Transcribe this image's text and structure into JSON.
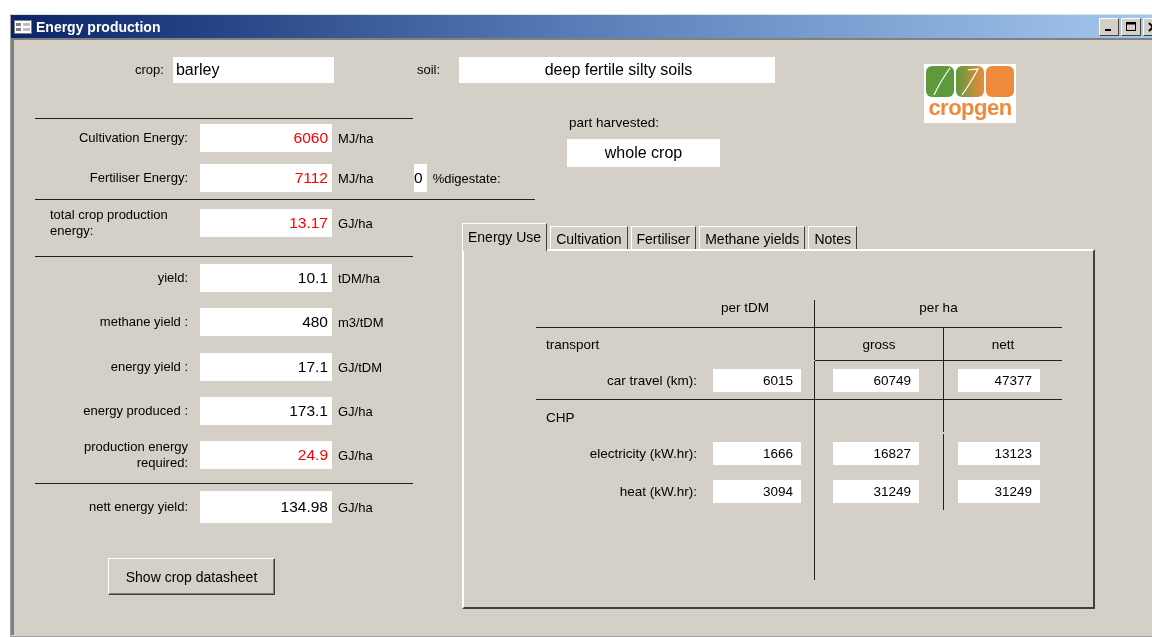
{
  "window": {
    "title": "Energy production"
  },
  "crop": {
    "label": "crop:",
    "value": "barley"
  },
  "soil": {
    "label": "soil:",
    "value": "deep fertile silty soils"
  },
  "logo": {
    "text": "cropgen"
  },
  "energy_inputs": [
    {
      "label": "Cultivation Energy:",
      "value": "6060",
      "unit": "MJ/ha",
      "color": "#ff0000"
    },
    {
      "label": "Fertiliser Energy:",
      "value": "7112",
      "unit": "MJ/ha",
      "color": "#ff0000",
      "extra": {
        "value": "0",
        "label": "%digestate:"
      }
    }
  ],
  "total": {
    "label": "total crop production energy:",
    "value": "13.17",
    "unit": "GJ/ha",
    "color": "#ff0000"
  },
  "outputs": [
    {
      "label": "yield:",
      "value": "10.1",
      "unit": "tDM/ha",
      "color": "#000000"
    },
    {
      "label": "methane yield :",
      "value": "480",
      "unit": "m3/tDM",
      "color": "#000000"
    },
    {
      "label": "energy yield :",
      "value": "17.1",
      "unit": "GJ/tDM",
      "color": "#000000"
    },
    {
      "label": "energy produced :",
      "value": "173.1",
      "unit": "GJ/ha",
      "color": "#000000"
    },
    {
      "label": "production energy required:",
      "value": "24.9",
      "unit": "GJ/ha",
      "color": "#ff0000"
    }
  ],
  "nett": {
    "label": "nett energy yield:",
    "value": "134.98",
    "unit": "GJ/ha",
    "color": "#000000"
  },
  "button": "Show crop datasheet",
  "part_harvested": {
    "label": "part harvested:",
    "value": "whole crop"
  },
  "tabs": [
    {
      "label": "Energy Use",
      "selected": true
    },
    {
      "label": "Cultivation",
      "selected": false
    },
    {
      "label": "Fertiliser",
      "selected": false
    },
    {
      "label": "Methane yields",
      "selected": false
    },
    {
      "label": "Notes",
      "selected": false
    }
  ],
  "energy_use": {
    "header_per_tdm": "per tDM",
    "header_per_ha": "per ha",
    "header_gross": "gross",
    "header_nett": "nett",
    "sections": [
      {
        "title": "transport",
        "rows": [
          {
            "label": "car travel (km):",
            "per_tdm": "6015",
            "gross": "60749",
            "nett": "47377"
          }
        ]
      },
      {
        "title": "CHP",
        "rows": [
          {
            "label": "electricity (kW.hr):",
            "per_tdm": "1666",
            "gross": "16827",
            "nett": "13123"
          },
          {
            "label": "heat (kW.hr):",
            "per_tdm": "3094",
            "gross": "31249",
            "nett": "31249"
          }
        ]
      }
    ]
  }
}
